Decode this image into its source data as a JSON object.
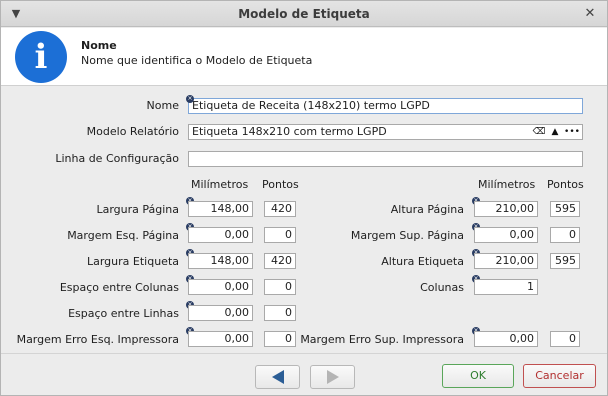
{
  "window": {
    "title": "Modelo de Etiqueta",
    "menu_icon": "chevron-down-icon",
    "close_icon": "close-icon"
  },
  "info": {
    "icon": "info-icon",
    "glyph": "i",
    "title": "Nome",
    "description": "Nome que identifica o Modelo de Etiqueta"
  },
  "form": {
    "nome": {
      "label": "Nome",
      "value": "Etiqueta de Receita (148x210) termo LGPD"
    },
    "modelo_relatorio": {
      "label": "Modelo Relatório",
      "value": "Etiqueta 148x210 com termo LGPD",
      "clear_glyph": "⌫",
      "up_glyph": "▲",
      "more_glyph": "•••"
    },
    "linha_configuracao": {
      "label": "Linha de Configuração",
      "value": ""
    },
    "headers": {
      "mm": "Milímetros",
      "pts": "Pontos"
    },
    "left": [
      {
        "label": "Largura Página",
        "mm": "148,00",
        "pts": "420"
      },
      {
        "label": "Margem Esq. Página",
        "mm": "0,00",
        "pts": "0"
      },
      {
        "label": "Largura Etiqueta",
        "mm": "148,00",
        "pts": "420"
      },
      {
        "label": "Espaço entre Colunas",
        "mm": "0,00",
        "pts": "0"
      },
      {
        "label": "Espaço entre Linhas",
        "mm": "0,00",
        "pts": "0"
      },
      {
        "label": "Margem Erro Esq. Impressora",
        "mm": "0,00",
        "pts": "0"
      }
    ],
    "right": [
      {
        "label": "Altura Página",
        "mm": "210,00",
        "pts": "595"
      },
      {
        "label": "Margem Sup. Página",
        "mm": "0,00",
        "pts": "0"
      },
      {
        "label": "Altura Etiqueta",
        "mm": "210,00",
        "pts": "595"
      },
      {
        "label": "Colunas",
        "value": "1"
      },
      {
        "label": "Margem Erro Sup. Impressora",
        "mm": "0,00",
        "pts": "0"
      }
    ]
  },
  "footer": {
    "prev_icon": "arrow-left-icon",
    "next_icon": "arrow-right-icon",
    "ok_label": "OK",
    "cancel_label": "Cancelar"
  }
}
